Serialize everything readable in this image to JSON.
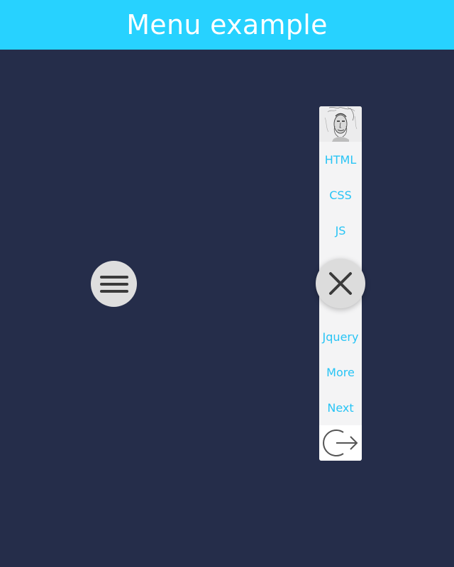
{
  "header": {
    "title": "Menu example",
    "bg_color": "#27d2ff"
  },
  "hamburger": {
    "icon": "hamburger-menu-icon"
  },
  "menu": {
    "avatar_icon": "portrait-sketch",
    "items": [
      {
        "label": "HTML"
      },
      {
        "label": "CSS"
      },
      {
        "label": "JS"
      },
      {
        "label": "Jquery"
      },
      {
        "label": "More"
      },
      {
        "label": "Next"
      }
    ],
    "logout_icon": "logout-arrow-icon",
    "item_color": "#27c4f5"
  },
  "close": {
    "icon": "close-x-icon"
  },
  "colors": {
    "background": "#252d4a",
    "panel": "#f4f4f5"
  }
}
